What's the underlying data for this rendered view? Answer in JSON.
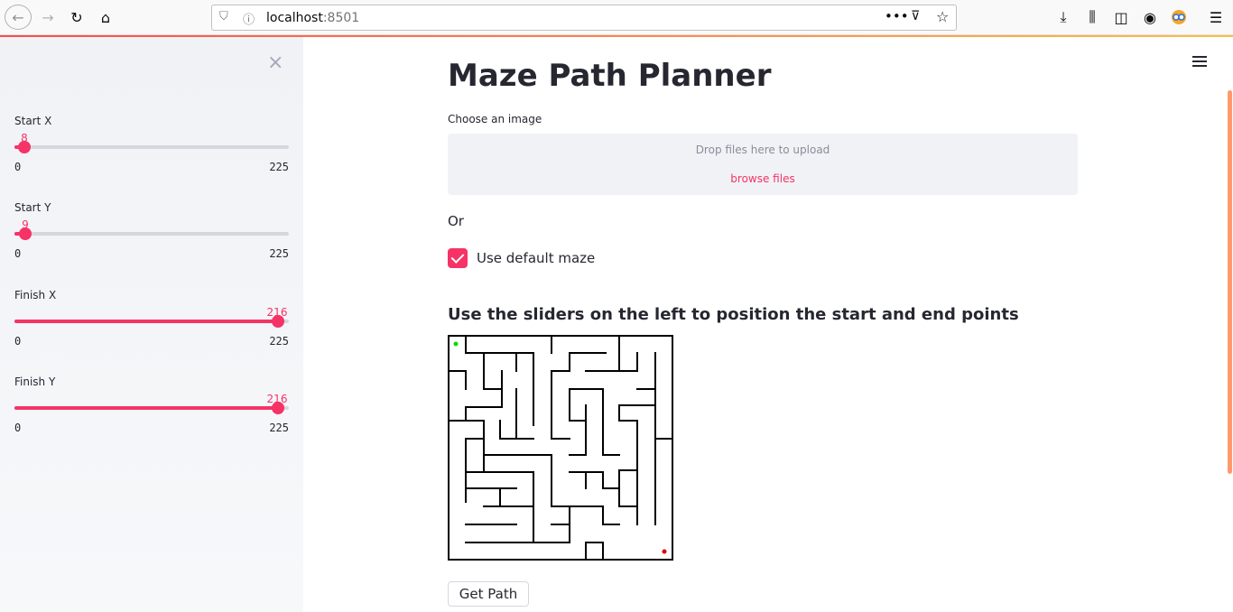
{
  "browser": {
    "url_host": "localhost",
    "url_port": ":8501"
  },
  "sidebar": {
    "close_glyph": "×",
    "sliders": [
      {
        "label": "Start X",
        "value": "8",
        "min": "0",
        "max": "225"
      },
      {
        "label": "Start Y",
        "value": "9",
        "min": "0",
        "max": "225"
      },
      {
        "label": "Finish X",
        "value": "216",
        "min": "0",
        "max": "225"
      },
      {
        "label": "Finish Y",
        "value": "216",
        "min": "0",
        "max": "225"
      }
    ]
  },
  "main": {
    "title": "Maze Path Planner",
    "uploader": {
      "label": "Choose an image",
      "drop_text": "Drop files here to upload",
      "browse_text": "browse files"
    },
    "or_text": "Or",
    "checkbox": {
      "label": "Use default maze",
      "checked": true
    },
    "subheading": "Use the sliders on the left to position the start and end points",
    "button_label": "Get Path"
  },
  "colors": {
    "accent": "#f63366",
    "start_marker": "#00e000",
    "finish_marker": "#e00000"
  }
}
